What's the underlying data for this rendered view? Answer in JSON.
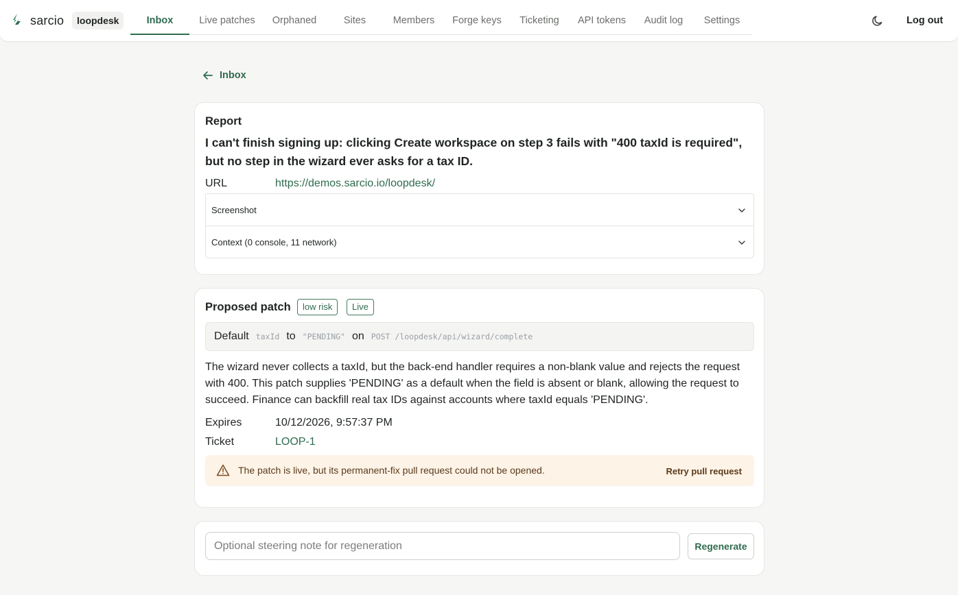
{
  "header": {
    "brand": "sarcio",
    "workspace": "loopdesk",
    "nav": [
      {
        "label": "Inbox",
        "active": true
      },
      {
        "label": "Live patches"
      },
      {
        "label": "Orphaned"
      },
      {
        "label": "Sites"
      },
      {
        "label": "Members"
      },
      {
        "label": "Forge keys"
      },
      {
        "label": "Ticketing"
      },
      {
        "label": "API tokens"
      },
      {
        "label": "Audit log"
      },
      {
        "label": "Settings"
      }
    ],
    "theme_icon": "moon-icon",
    "logout_label": "Log out"
  },
  "back": {
    "label": "Inbox",
    "icon": "arrow-left-icon"
  },
  "report": {
    "heading": "Report",
    "title": "I can't finish signing up: clicking Create workspace on step 3 fails with \"400 taxId is required\", but no step in the wizard ever asks for a tax ID.",
    "url_label": "URL",
    "url_value": "https://demos.sarcio.io/loopdesk/",
    "screenshot_label": "Screenshot",
    "context_label": "Context (0 console, 11 network)"
  },
  "patch": {
    "heading": "Proposed patch",
    "risk_badge": "low risk",
    "status_badge": "Live",
    "summary": {
      "word_default": "Default",
      "field": "taxId",
      "word_to": "to",
      "value": "\"PENDING\"",
      "word_on": "on",
      "endpoint": "POST /loopdesk/api/wizard/complete"
    },
    "description": "The wizard never collects a taxId, but the back-end handler requires a non-blank value and rejects the request with 400. This patch supplies 'PENDING' as a default when the field is absent or blank, allowing the request to succeed. Finance can backfill real tax IDs against accounts where taxId equals 'PENDING'.",
    "expires_label": "Expires",
    "expires_value": "10/12/2026, 9:57:37 PM",
    "ticket_label": "Ticket",
    "ticket_value": "LOOP-1",
    "warning": {
      "icon": "warning-triangle-icon",
      "text": "The patch is live, but its permanent-fix pull request could not be opened.",
      "action": "Retry pull request"
    }
  },
  "regenerate": {
    "placeholder": "Optional steering note for regeneration",
    "value": "",
    "button": "Regenerate"
  },
  "colors": {
    "accent": "#2f6b4f",
    "background": "#f6f6f4",
    "warning_bg": "#fdf3e7",
    "warning_text": "#5b3a1a"
  }
}
